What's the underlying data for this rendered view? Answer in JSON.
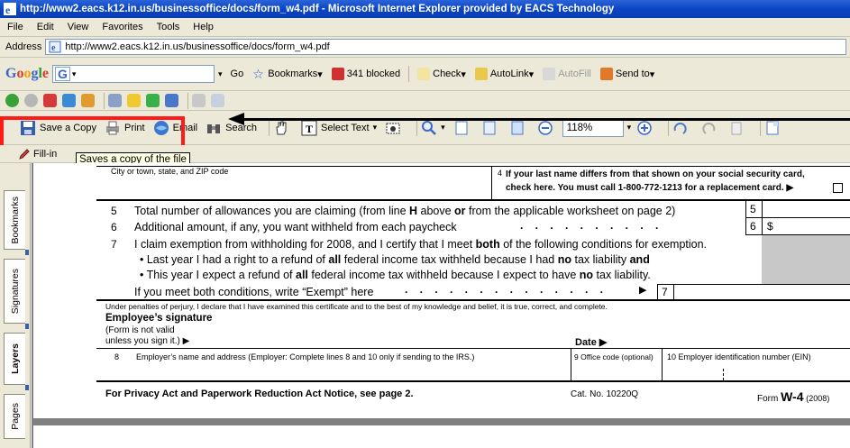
{
  "window": {
    "title": "http://www2.eacs.k12.in.us/businessoffice/docs/form_w4.pdf - Microsoft Internet Explorer provided by EACS Technology"
  },
  "menu": [
    "File",
    "Edit",
    "View",
    "Favorites",
    "Tools",
    "Help"
  ],
  "address": {
    "label": "Address",
    "url": "http://www2.eacs.k12.in.us/businessoffice/docs/form_w4.pdf"
  },
  "google_toolbar": {
    "go_label": "Go",
    "bookmarks_label": "Bookmarks",
    "blocked_label": "341 blocked",
    "check_label": "Check",
    "autolink_label": "AutoLink",
    "autofill_label": "AutoFill",
    "sendto_label": "Send to"
  },
  "pdf_toolbar": {
    "save_label": "Save a Copy",
    "print_label": "Print",
    "email_label": "Email",
    "search_label": "Search",
    "select_text_label": "Select Text",
    "zoom_value": "118%",
    "fillin_label": "Fill-in"
  },
  "tooltip": "Saves a copy of the file",
  "side_tabs": [
    "Bookmarks",
    "Signatures",
    "Layers",
    "Pages"
  ],
  "form": {
    "line_city": "City or town, state, and ZIP code",
    "line4a_num": "4",
    "line4a": "If your last name differs from that shown on your social security card,",
    "line4b": "check here. You must call 1-800-772-1213 for a replacement card. ▶",
    "line5_num": "5",
    "line5_pre": "Total number of allowances you are claiming (from line ",
    "line5_bold": "H",
    "line5_mid": " above ",
    "line5_bold2": "or",
    "line5_post": " from the applicable worksheet on page 2)",
    "line6_num": "6",
    "line6": "Additional amount, if any, you want withheld from each paycheck",
    "line7_num": "7",
    "line7_pre": "I claim exemption from withholding for 2008, and I certify that I meet ",
    "line7_bold": "both",
    "line7_post": " of the following conditions for exemption.",
    "bullet1_pre": "• Last year I had a right to a refund of ",
    "bullet1_b1": "all",
    "bullet1_mid": " federal income tax withheld because I had ",
    "bullet1_b2": "no",
    "bullet1_mid2": " tax liability ",
    "bullet1_b3": "and",
    "bullet2_pre": "• This year I expect a refund of ",
    "bullet2_b1": "all",
    "bullet2_mid": " federal income tax withheld because I expect to have ",
    "bullet2_b2": "no",
    "bullet2_post": " tax liability.",
    "exempt_line": "If you meet both conditions, write “Exempt” here",
    "exempt_arrow": "▶",
    "box5": "5",
    "box6": "6",
    "box6_dollar": "$",
    "box7": "7",
    "perjury": "Under penalties of perjury, I declare that I have examined this certificate and to the best of my knowledge and belief, it is true, correct, and complete.",
    "sig_title": "Employee’s signature",
    "sig_sub1": "(Form is not valid",
    "sig_sub2": "unless you sign it.) ▶",
    "date_label": "Date ▶",
    "line8_num": "8",
    "line8": "Employer’s name and address (Employer: Complete lines 8 and 10 only if sending to the IRS.)",
    "line9": "9  Office code (optional)",
    "line10": "10   Employer identification number (EIN)",
    "privacy": "For Privacy Act and Paperwork Reduction Act Notice, see page 2.",
    "cat": "Cat. No. 10220Q",
    "form_label": "Form",
    "form_name": "W-4",
    "form_year": "(2008)"
  }
}
